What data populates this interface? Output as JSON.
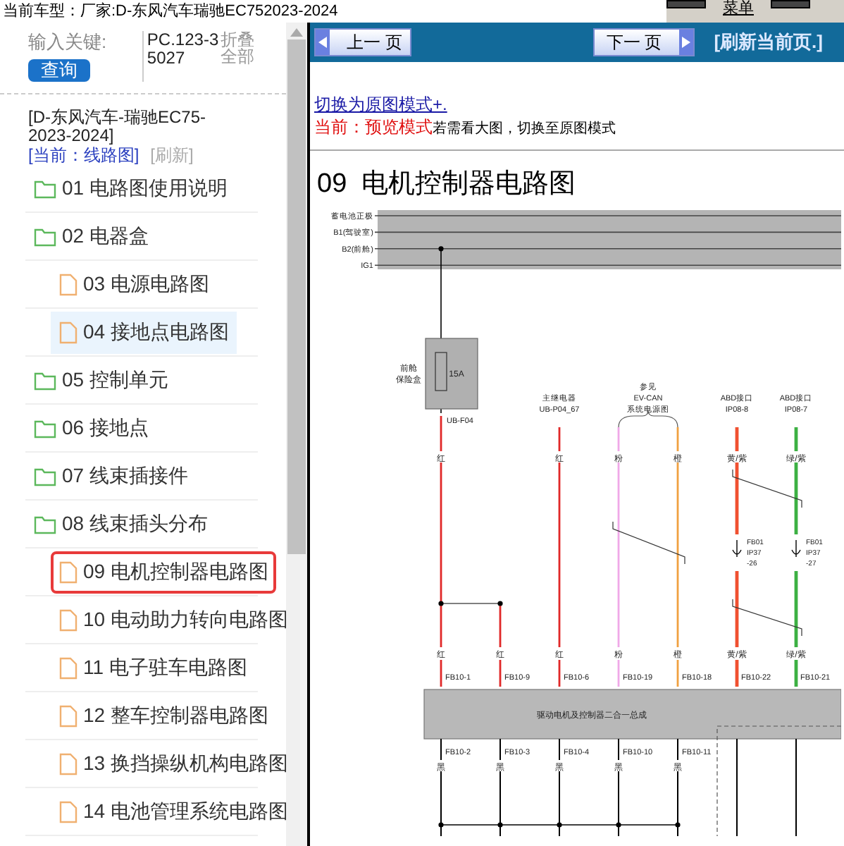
{
  "top_bar": {
    "model_label": "当前车型：",
    "model_value": "厂家:D-东风汽车瑞驰EC752023-2024",
    "menu": "菜单"
  },
  "sidebar": {
    "keyword_label": "输入关键:",
    "search_button": "查询",
    "keyword_value": "PC.123-35027",
    "collapse_all": "折叠全部",
    "vehicle": "[D-东风汽车-瑞驰EC75-2023-2024]",
    "current_mode": "[当前：线路图]",
    "refresh": "[刷新]",
    "items": [
      {
        "kind": "folder",
        "label": "01 电路图使用说明",
        "selected": false,
        "hovered": false
      },
      {
        "kind": "folder",
        "label": "02 电器盒",
        "selected": false,
        "hovered": false,
        "children": [
          {
            "kind": "file",
            "label": "03 电源电路图",
            "selected": false,
            "hovered": false
          },
          {
            "kind": "file",
            "label": "04 接地点电路图",
            "selected": false,
            "hovered": true
          }
        ]
      },
      {
        "kind": "folder",
        "label": "05 控制单元",
        "selected": false,
        "hovered": false
      },
      {
        "kind": "folder",
        "label": "06 接地点",
        "selected": false,
        "hovered": false
      },
      {
        "kind": "folder",
        "label": "07 线束插接件",
        "selected": false,
        "hovered": false
      },
      {
        "kind": "folder",
        "label": "08 线束插头分布",
        "selected": false,
        "hovered": false,
        "children": [
          {
            "kind": "file",
            "label": "09 电机控制器电路图",
            "selected": true,
            "hovered": false
          },
          {
            "kind": "file",
            "label": "10 电动助力转向电路图",
            "selected": false,
            "hovered": false
          },
          {
            "kind": "file",
            "label": "11 电子驻车电路图",
            "selected": false,
            "hovered": false
          },
          {
            "kind": "file",
            "label": "12 整车控制器电路图",
            "selected": false,
            "hovered": false
          },
          {
            "kind": "file",
            "label": "13 换挡操纵机构电路图",
            "selected": false,
            "hovered": false
          },
          {
            "kind": "file",
            "label": "14 电池管理系统电路图",
            "selected": false,
            "hovered": false
          }
        ]
      }
    ]
  },
  "toolbar": {
    "prev": "上一 页",
    "next": "下一 页",
    "refresh": "[刷新当前页.]"
  },
  "mode": {
    "switch_link": "切换为原图模式+.",
    "current": "当前：预览模式",
    "hint": "若需看大图，切换至原图模式"
  },
  "heading": "09  电机控制器电路图",
  "diagram": {
    "buses": [
      "蓄电池正极",
      "B1(驾驶室)",
      "B2(前舱)",
      "IG1"
    ],
    "fuse_box": {
      "lines": [
        "前舱",
        "保险盒"
      ],
      "rating": "15A",
      "connector": "UB-F04"
    },
    "sources": [
      {
        "lines": [
          "主继电器",
          "UB-P04_67"
        ]
      },
      {
        "lines": [
          "参见",
          "EV-CAN",
          "系统电源图"
        ]
      },
      {
        "lines": [
          "ABD接口",
          "IP08-8"
        ]
      },
      {
        "lines": [
          "ABD接口",
          "IP08-7"
        ]
      }
    ],
    "upper_labels": [
      "红",
      "红",
      "粉",
      "橙",
      "黄/紫",
      "绿/紫"
    ],
    "inline_connectors": [
      {
        "lines": [
          "FB01",
          "IP37",
          "-26"
        ]
      },
      {
        "lines": [
          "FB01",
          "IP37",
          "-27"
        ]
      }
    ],
    "input_pins": [
      {
        "wire": "红",
        "pin": "FB10-1",
        "color": "#e02828"
      },
      {
        "wire": "红",
        "pin": "FB10-9",
        "color": "#e02828"
      },
      {
        "wire": "红",
        "pin": "FB10-6",
        "color": "#e02828"
      },
      {
        "wire": "粉",
        "pin": "FB10-19",
        "color": "#f0a8e8"
      },
      {
        "wire": "橙",
        "pin": "FB10-18",
        "color": "#f0a040"
      },
      {
        "wire": "黄/紫",
        "pin": "FB10-22",
        "color": "#f05030"
      },
      {
        "wire": "绿/紫",
        "pin": "FB10-21",
        "color": "#3cb043"
      }
    ],
    "module": "驱动电机及控制器二合一总成",
    "output_pins": [
      {
        "pin": "FB10-2",
        "wire": "黑"
      },
      {
        "pin": "FB10-3",
        "wire": "黑"
      },
      {
        "pin": "FB10-4",
        "wire": "黑"
      },
      {
        "pin": "FB10-10",
        "wire": "黑"
      },
      {
        "pin": "FB10-11",
        "wire": "黑"
      }
    ]
  }
}
